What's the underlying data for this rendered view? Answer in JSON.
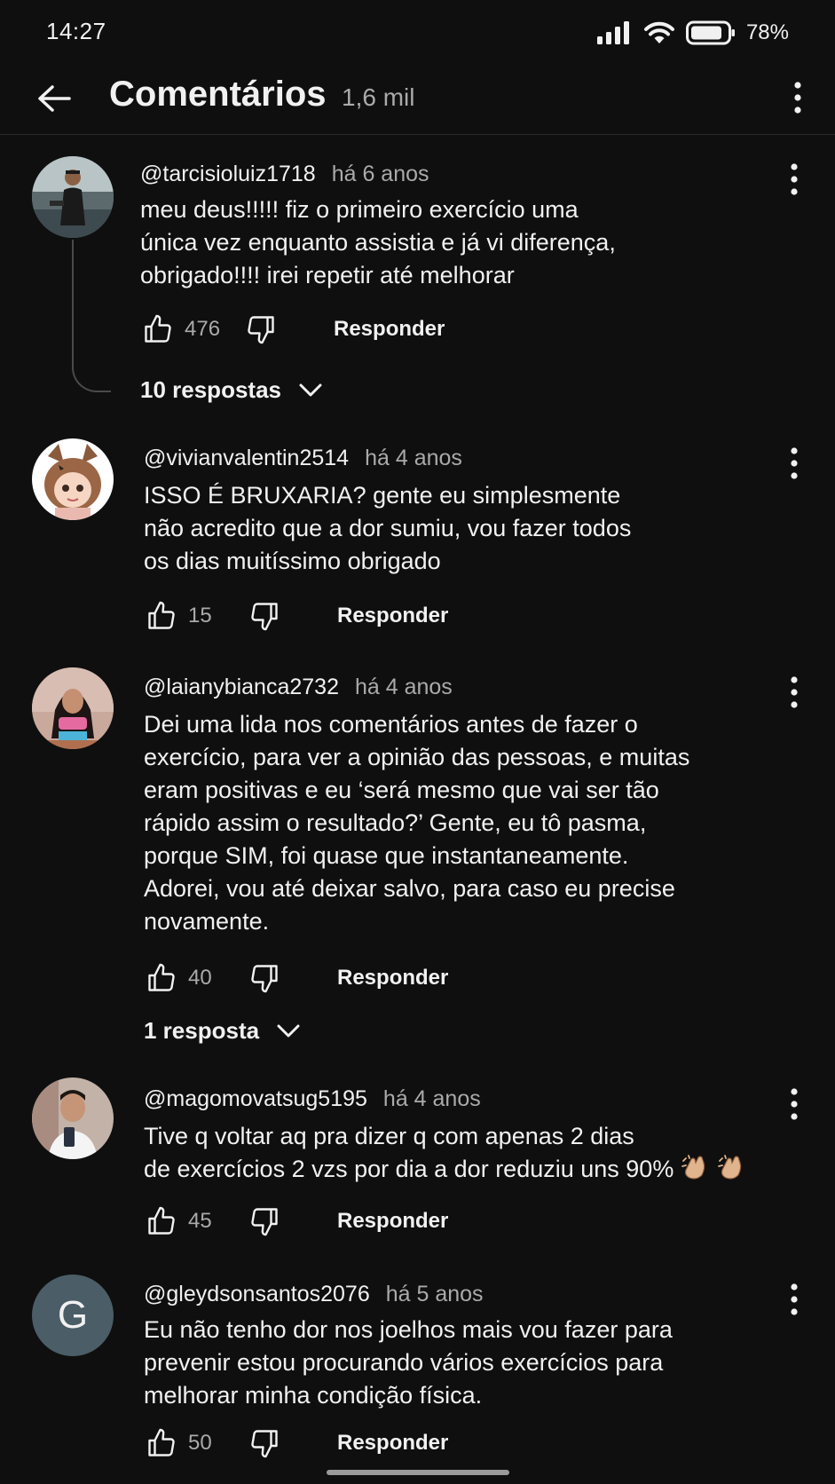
{
  "status_bar": {
    "time": "14:27",
    "battery": "78%"
  },
  "header": {
    "title": "Comentários",
    "count": "1,6 mil"
  },
  "comments": [
    {
      "handle": "@tarcisioluiz1718",
      "time": "há 6 anos",
      "lines": [
        "meu deus!!!!! fiz o primeiro exercício uma",
        "única vez enquanto assistia e já vi diferença,",
        "obrigado!!!! irei repetir até melhorar"
      ],
      "likes": "476",
      "reply_label": "Responder",
      "replies_label": "10 respostas"
    },
    {
      "handle": "@vivianvalentin2514",
      "time": "há 4 anos",
      "lines": [
        "ISSO É BRUXARIA? gente eu simplesmente",
        "não acredito que a dor sumiu, vou fazer todos",
        "os dias muitíssimo obrigado"
      ],
      "likes": "15",
      "reply_label": "Responder"
    },
    {
      "handle": "@laianybianca2732",
      "time": "há 4 anos",
      "lines": [
        "Dei uma lida nos comentários antes de fazer o",
        "exercício, para ver a opinião das pessoas, e muitas",
        "eram positivas e eu ‘será mesmo que vai ser tão",
        "rápido assim o resultado?’ Gente, eu tô pasma,",
        "porque SIM, foi quase que instantaneamente.",
        "Adorei, vou até deixar salvo, para caso eu precise",
        "novamente."
      ],
      "likes": "40",
      "reply_label": "Responder",
      "replies_label": "1 resposta"
    },
    {
      "handle": "@magomovatsug5195",
      "time": "há 4 anos",
      "lines": [
        "Tive q voltar aq pra dizer q com apenas 2 dias",
        "de exercícios 2 vzs por dia a dor reduziu uns 90%"
      ],
      "likes": "45",
      "reply_label": "Responder"
    },
    {
      "handle": "@gleydsonsantos2076",
      "time": "há 5 anos",
      "avatar_letter": "G",
      "lines": [
        "Eu não tenho dor nos joelhos mais vou fazer para",
        "prevenir estou procurando vários exercícios para",
        "melhorar minha condição física."
      ],
      "likes": "50",
      "reply_label": "Responder"
    }
  ],
  "colors": {
    "background": "#0f0f0f",
    "text": "#f1f1f1",
    "secondary": "#aaaaaa",
    "avatar_g": "#4b5d67"
  }
}
